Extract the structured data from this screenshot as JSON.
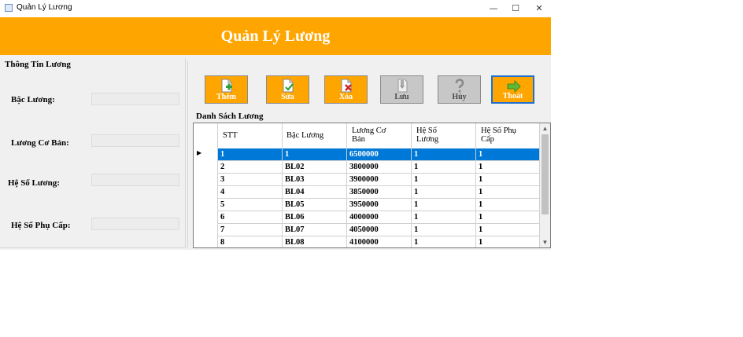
{
  "window": {
    "title": "Quản Lý Lương",
    "minimize": "—",
    "maximize": "☐",
    "close": "✕"
  },
  "header": {
    "title": "Quản Lý Lương"
  },
  "info": {
    "title": "Thông Tin Lương",
    "fields": [
      {
        "label": "Bậc Lương:",
        "value": ""
      },
      {
        "label": "Lương Cơ Bản:",
        "value": ""
      },
      {
        "label": "Hệ Số Lương:",
        "value": ""
      },
      {
        "label": "Hệ Số Phụ Cấp:",
        "value": ""
      }
    ]
  },
  "toolbar": {
    "buttons": [
      {
        "label": "Thêm",
        "icon": "add-document-icon"
      },
      {
        "label": "Sửa",
        "icon": "edit-document-icon"
      },
      {
        "label": "Xóa",
        "icon": "delete-document-icon"
      },
      {
        "label": "Lưu",
        "icon": "save-icon"
      },
      {
        "label": "Hủy",
        "icon": "question-icon"
      },
      {
        "label": "Thoát",
        "icon": "exit-arrow-icon"
      }
    ],
    "accent": "#ffa500",
    "selected_border": "#1e6fd0"
  },
  "list": {
    "title": "Danh Sách Lương",
    "columns": [
      "STT",
      "Bậc Lương",
      "Lương Cơ Bản",
      "Hệ Số Lương",
      "Hệ Số Phụ Cấp"
    ],
    "rows": [
      [
        "1",
        "1",
        "6500000",
        "1",
        "1"
      ],
      [
        "2",
        "BL02",
        "3800000",
        "1",
        "1"
      ],
      [
        "3",
        "BL03",
        "3900000",
        "1",
        "1"
      ],
      [
        "4",
        "BL04",
        "3850000",
        "1",
        "1"
      ],
      [
        "5",
        "BL05",
        "3950000",
        "1",
        "1"
      ],
      [
        "6",
        "BL06",
        "4000000",
        "1",
        "1"
      ],
      [
        "7",
        "BL07",
        "4050000",
        "1",
        "1"
      ],
      [
        "8",
        "BL08",
        "4100000",
        "1",
        "1"
      ]
    ],
    "selected_row": 0,
    "selection_color": "#0078d7"
  }
}
